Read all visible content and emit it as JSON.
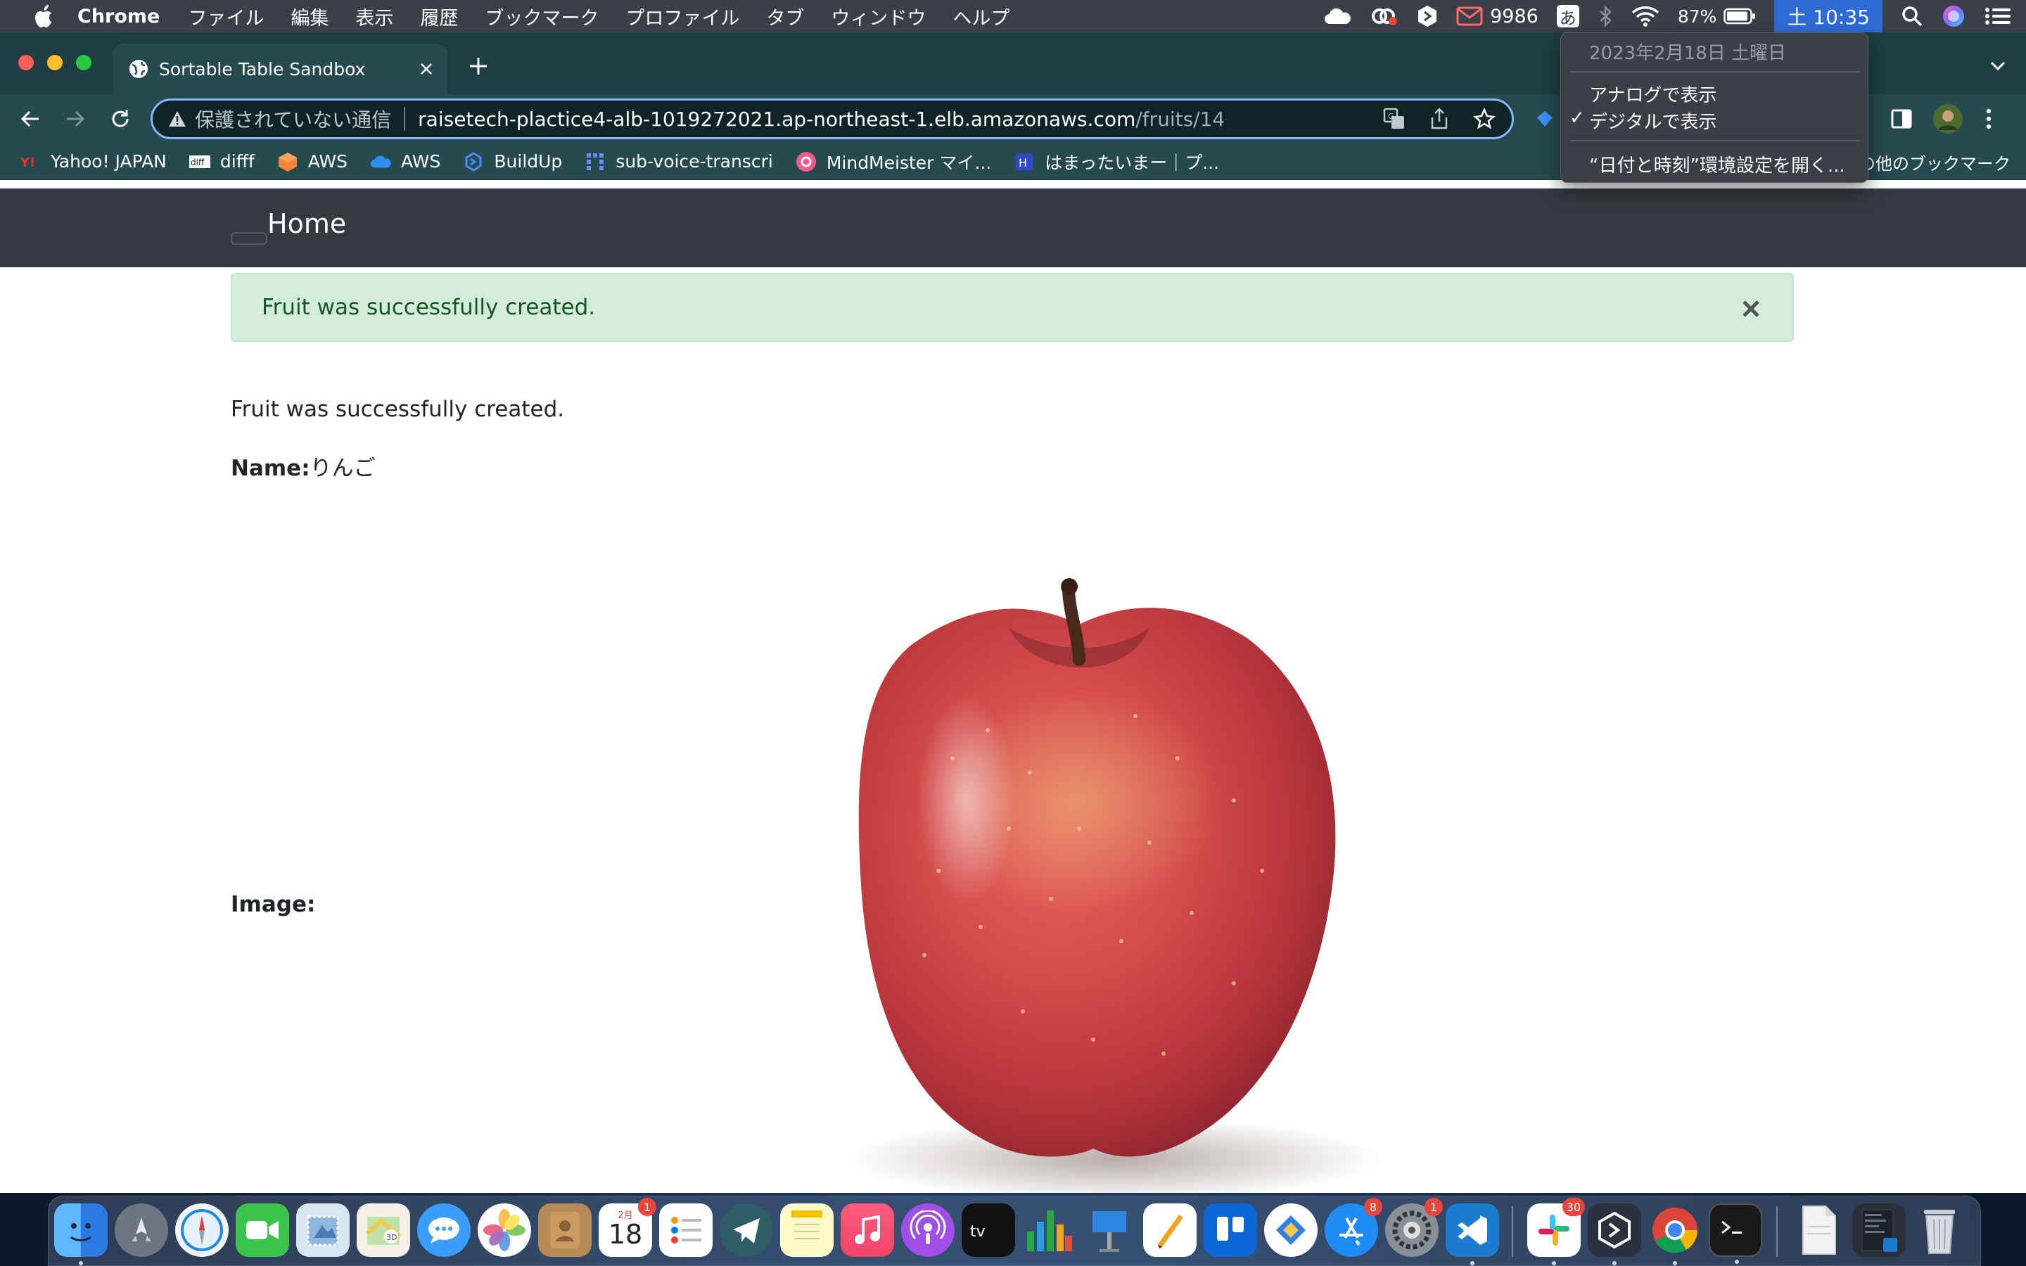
{
  "menubar": {
    "app_name": "Chrome",
    "menus": [
      "ファイル",
      "編集",
      "表示",
      "履歴",
      "ブックマーク",
      "プロファイル",
      "タブ",
      "ウィンドウ",
      "ヘルプ"
    ],
    "mail_count": "9986",
    "ime": "あ",
    "battery": "87%",
    "clock": "土 10:35"
  },
  "clock_menu": {
    "date": "2023年2月18日 土曜日",
    "analog": "アナログで表示",
    "digital": "デジタルで表示",
    "checkmark": "✓",
    "open_prefs": "“日付と時刻”環境設定を開く..."
  },
  "browser": {
    "tab_title": "Sortable Table Sandbox",
    "security_label": "保護されていない通信",
    "url_host": "raisetech-plactice4-alb-1019272021.ap-northeast-1.elb.amazonaws.com",
    "url_path": "/fruits/14",
    "bookmarks": [
      "Yahoo! JAPAN",
      "difff",
      "AWS",
      "AWS",
      "BuildUp",
      "sub-voice-transcri",
      "MindMeister マイ...",
      "はまったいまー｜プ..."
    ],
    "other_bookmarks": "の他のブックマーク"
  },
  "page": {
    "brand": "Home",
    "alert": "Fruit was successfully created.",
    "notice": "Fruit was successfully created.",
    "name_label": "Name:",
    "name_value": "りんご",
    "image_label": "Image:"
  },
  "dock": {
    "calendar_month": "2月",
    "calendar_day": "18",
    "badges": {
      "calendar": "1",
      "appstore": "8",
      "settings": "1",
      "slack": "30"
    }
  },
  "colors": {
    "chrome_frame": "#254a4f",
    "navbar": "#343a40",
    "alert_bg": "#d4edda",
    "alert_text": "#155724",
    "clock_highlight": "#2f6bd6"
  }
}
